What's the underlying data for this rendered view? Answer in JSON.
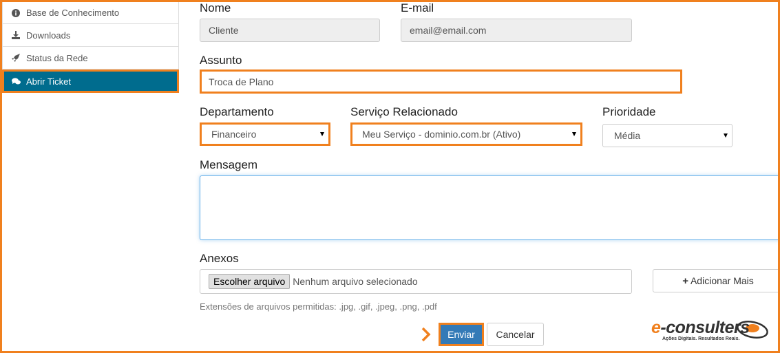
{
  "sidebar": {
    "items": [
      {
        "label": "Base de Conhecimento",
        "icon": "info-circle-icon"
      },
      {
        "label": "Downloads",
        "icon": "download-icon"
      },
      {
        "label": "Status da Rede",
        "icon": "rocket-icon"
      },
      {
        "label": "Abrir Ticket",
        "icon": "comments-icon",
        "active": true
      }
    ]
  },
  "form": {
    "name": {
      "label": "Nome",
      "value": "Cliente"
    },
    "email": {
      "label": "E-mail",
      "value": "email@email.com"
    },
    "subject": {
      "label": "Assunto",
      "value": "Troca de Plano"
    },
    "department": {
      "label": "Departamento",
      "value": "Financeiro"
    },
    "service": {
      "label": "Serviço Relacionado",
      "value": "Meu Serviço - dominio.com.br (Ativo)"
    },
    "priority": {
      "label": "Prioridade",
      "value": "Média"
    },
    "message": {
      "label": "Mensagem",
      "value": ""
    },
    "attachments": {
      "label": "Anexos",
      "choose_label": "Escolher arquivo",
      "status": "Nenhum arquivo selecionado",
      "add_more_label": "Adicionar Mais",
      "help": "Extensões de arquivos permitidas: .jpg, .gif, .jpeg, .png, .pdf"
    },
    "submit_label": "Enviar",
    "cancel_label": "Cancelar"
  },
  "logo": {
    "text": "e-consulters",
    "tagline": "Ações Digitais. Resultados Reais."
  },
  "colors": {
    "highlight": "#f0801e",
    "active_nav": "#006c8e",
    "primary_button": "#337ab7"
  }
}
